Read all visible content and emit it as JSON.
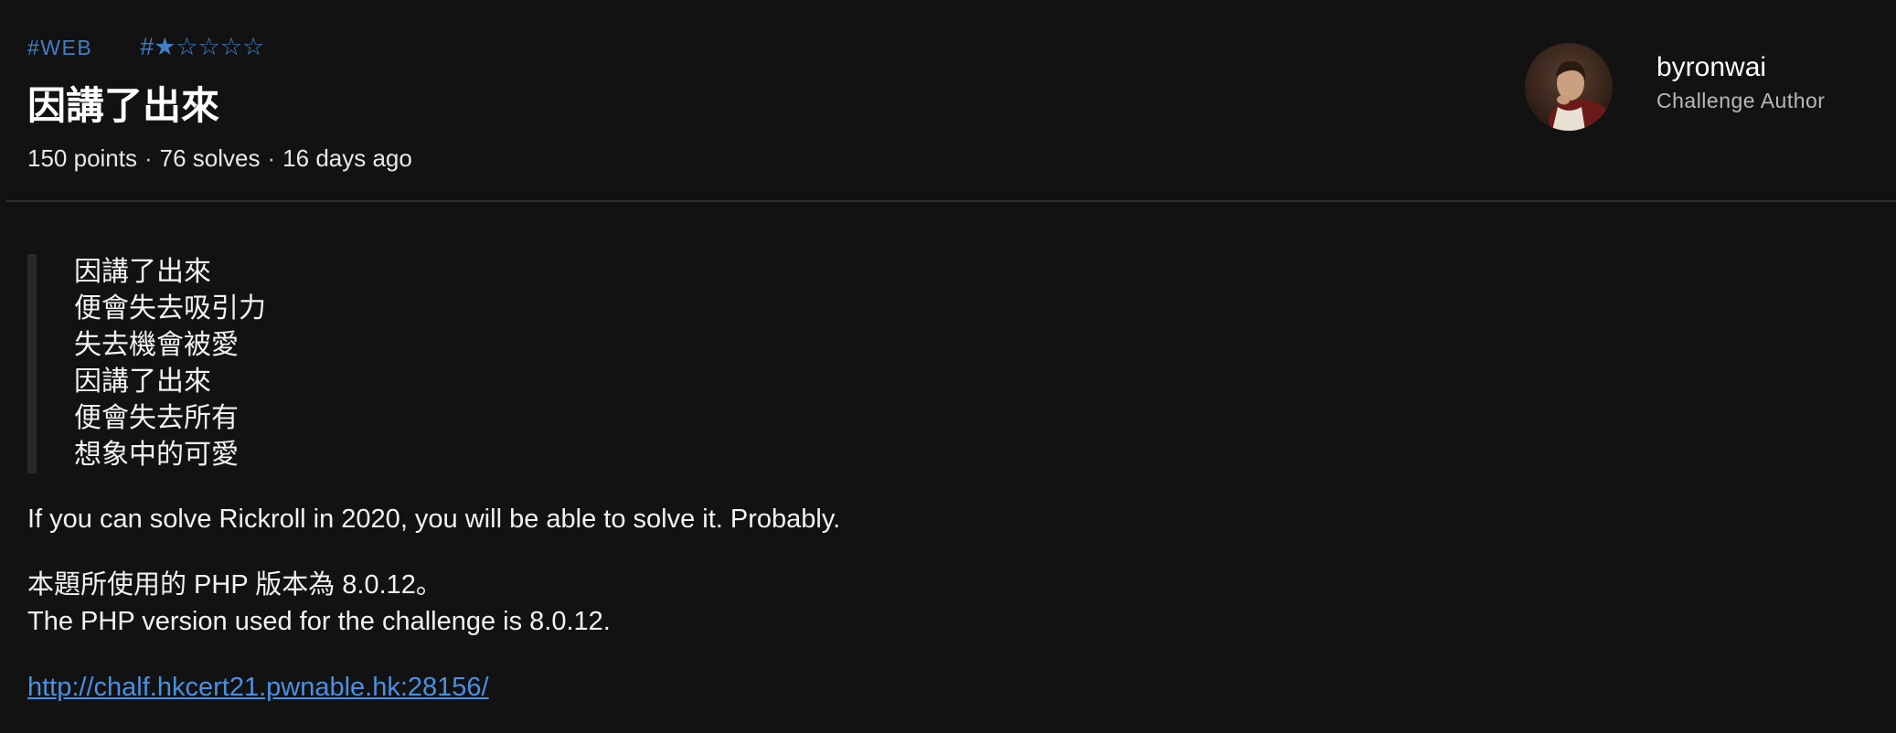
{
  "challenge": {
    "category_tag": "#WEB",
    "difficulty_tag": "#★☆☆☆☆",
    "title": "因講了出來",
    "points": "150 points",
    "solves": "76 solves",
    "age": "16 days ago",
    "meta_separator": "·"
  },
  "author": {
    "name": "byronwai",
    "role": "Challenge Author",
    "avatar_icon": "portrait-avatar"
  },
  "description": {
    "quote_lines": [
      "因講了出來",
      "便會失去吸引力",
      "失去機會被愛",
      "因講了出來",
      "便會失去所有",
      "想象中的可愛"
    ],
    "hint": "If you can solve Rickroll in 2020, you will be able to solve it. Probably.",
    "php_version_zh": "本題所使用的 PHP 版本為 8.0.12。",
    "php_version_en": "The PHP version used for the challenge is 8.0.12.",
    "url": "http://chalf.hkcert21.pwnable.hk:28156/"
  },
  "colors": {
    "background": "#121212",
    "tag": "#3f7fc6",
    "link": "#4a90e2",
    "divider": "#2c2c2c",
    "quote_bar": "#2a2a2a"
  }
}
